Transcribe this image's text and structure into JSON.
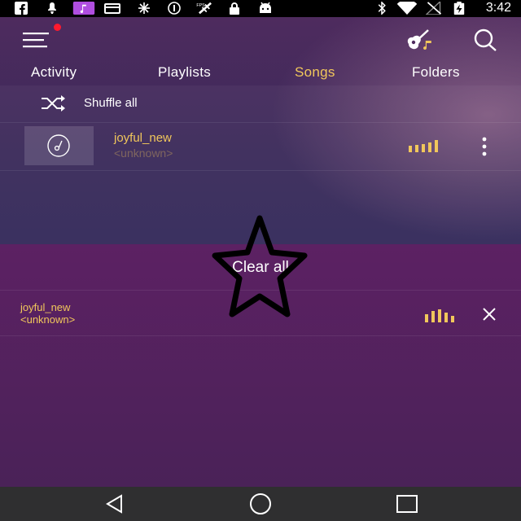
{
  "status_bar": {
    "time": "3:42",
    "icons": [
      "facebook-icon",
      "notification-icon",
      "music-app-icon",
      "folder-icon",
      "signal-dots-icon",
      "info-icon",
      "no-gps-icon",
      "lock-icon",
      "android-icon",
      "bluetooth-icon",
      "wifi-icon",
      "no-sim-icon",
      "battery-charging-icon"
    ]
  },
  "app_bar": {
    "menu_icon": "menu-icon",
    "has_notification_dot": true,
    "guitar_icon": "guitar-music-icon",
    "search_icon": "search-icon"
  },
  "tabs": [
    {
      "label": "Activity",
      "active": false
    },
    {
      "label": "Playlists",
      "active": false
    },
    {
      "label": "Songs",
      "active": true
    },
    {
      "label": "Folders",
      "active": false
    }
  ],
  "shuffle": {
    "label": "Shuffle all",
    "icon": "shuffle-icon"
  },
  "songs": [
    {
      "title": "joyful_new",
      "artist": "<unknown>",
      "playing": true
    }
  ],
  "queue": {
    "clear_label": "Clear all",
    "items": [
      {
        "title": "joyful_new",
        "artist": "<unknown>",
        "playing": true
      }
    ]
  },
  "colors": {
    "accent": "#f1c75b",
    "notification": "#ff1a2e",
    "queue_bg": "#552160",
    "nav_bg": "#2f2f30"
  }
}
